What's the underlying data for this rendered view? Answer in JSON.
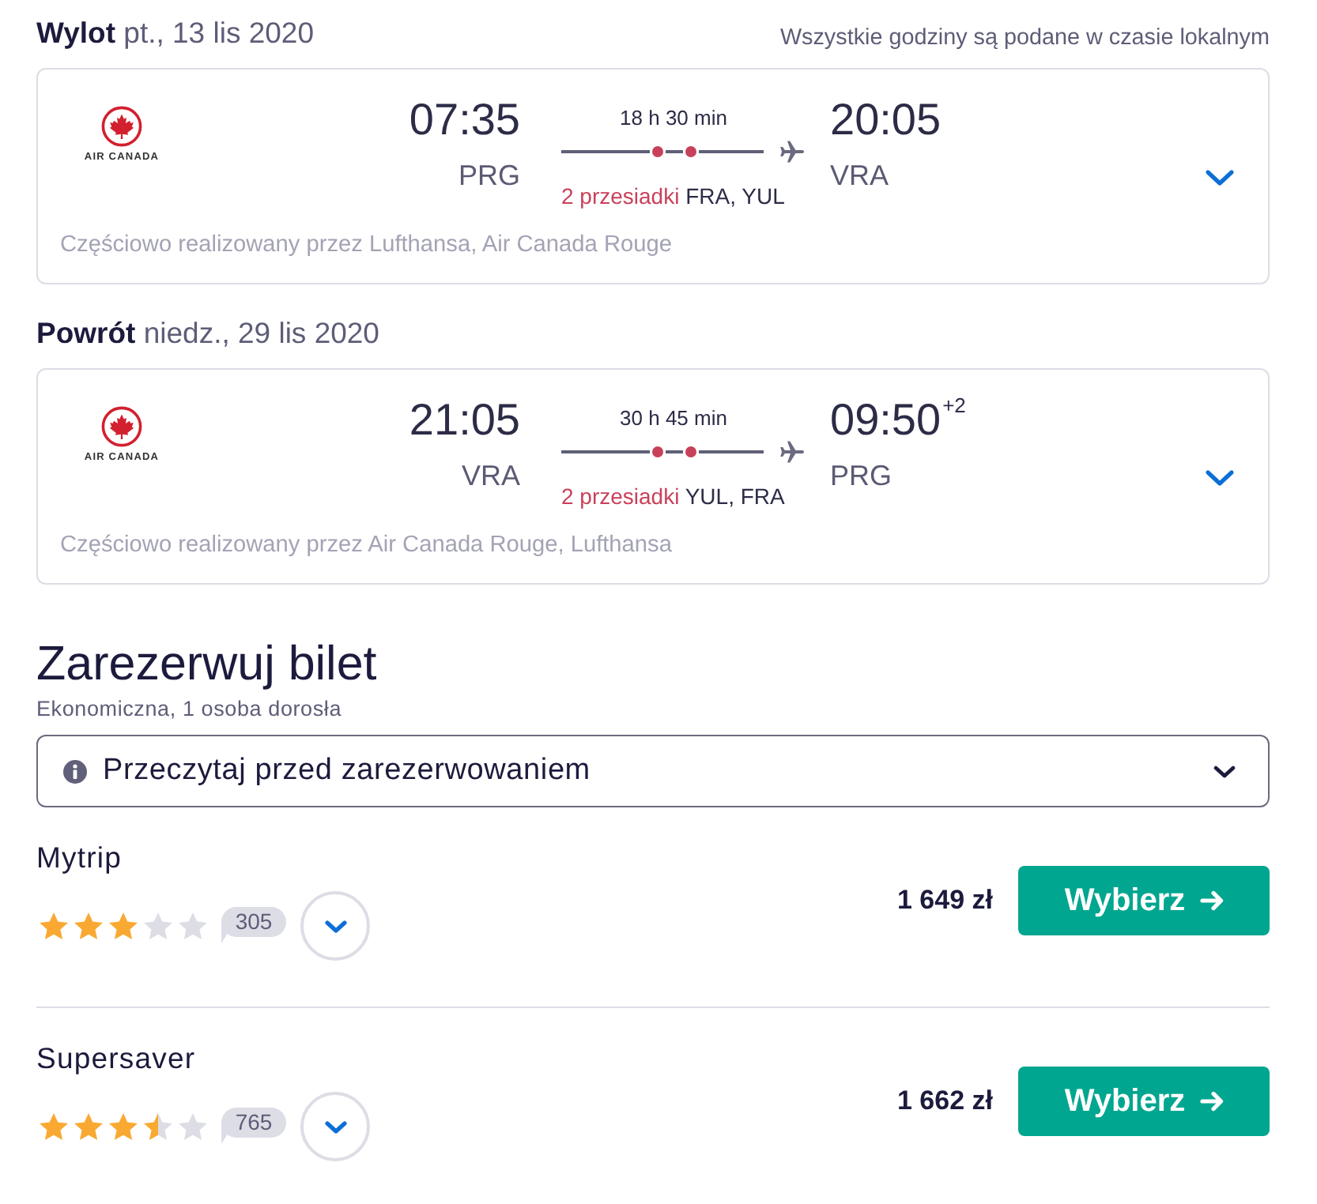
{
  "timezone_note": "Wszystkie godziny są podane w czasie lokalnym",
  "flights": [
    {
      "label": "Wylot",
      "date": "pt., 13 lis 2020",
      "airline_logo_text": "AIR CANADA",
      "departure": {
        "time": "07:35",
        "airport": "PRG"
      },
      "duration": "18 h 30 min",
      "stops_count": "2 przesiadki",
      "stops": "FRA, YUL",
      "arrival": {
        "time": "20:05",
        "airport": "VRA"
      },
      "operated_by": "Częściowo realizowany przez Lufthansa, Air Canada Rouge",
      "expanded": false
    },
    {
      "label": "Powrót",
      "date": "niedz., 29 lis 2020",
      "airline_logo_text": "AIR CANADA",
      "departure": {
        "time": "21:05",
        "airport": "VRA"
      },
      "duration": "30 h 45 min",
      "stops_count": "2 przesiadki",
      "stops": "YUL, FRA",
      "arrival": {
        "time": "09:50",
        "day_offset": "+2",
        "airport": "PRG"
      },
      "operated_by": "Częściowo realizowany przez Air Canada Rouge, Lufthansa",
      "expanded": false
    }
  ],
  "booking": {
    "title": "Zarezerwuj bilet",
    "subtitle": "Ekonomiczna, 1 osoba dorosła",
    "notice": {
      "label": "Przeczytaj przed zarezerwowaniem",
      "expanded": false
    },
    "offers": [
      {
        "provider": "Mytrip",
        "stars": 3,
        "reviews": "305",
        "price": "1 649 zł",
        "button": "Wybierz",
        "expanded": false
      },
      {
        "provider": "Supersaver",
        "stars": 3.5,
        "reviews": "765",
        "price": "1 662 zł",
        "button": "Wybierz",
        "expanded": false
      }
    ]
  }
}
